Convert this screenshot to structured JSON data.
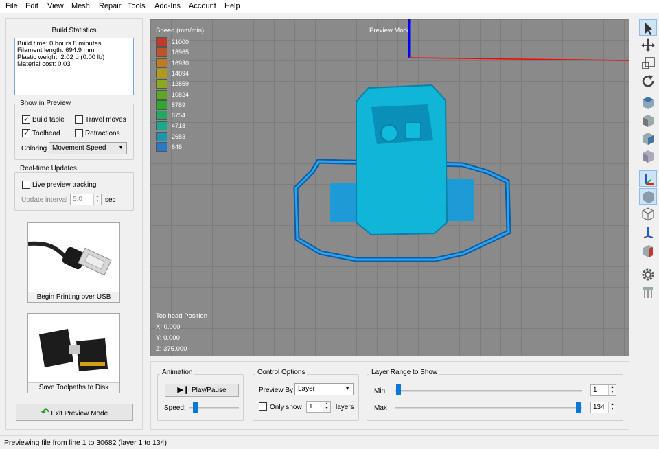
{
  "menu": [
    "File",
    "Edit",
    "View",
    "Mesh",
    "Repair",
    "Tools",
    "Add-Ins",
    "Account",
    "Help"
  ],
  "build_statistics": {
    "title": "Build Statistics",
    "build_time": "Build time: 0 hours 8 minutes",
    "filament_length": "Filament length: 694.9 mm",
    "plastic_weight": "Plastic weight: 2.02 g (0.00 lb)",
    "material_cost": "Material cost: 0.03"
  },
  "show_in_preview": {
    "title": "Show in Preview",
    "build_table": {
      "label": "Build table",
      "checked": true
    },
    "travel_moves": {
      "label": "Travel moves",
      "checked": false
    },
    "toolhead": {
      "label": "Toolhead",
      "checked": true
    },
    "retractions": {
      "label": "Retractions",
      "checked": false
    },
    "coloring_label": "Coloring",
    "coloring_value": "Movement Speed"
  },
  "realtime": {
    "title": "Real-time Updates",
    "live_preview_label": "Live preview tracking",
    "live_preview_checked": false,
    "update_interval_label": "Update interval",
    "update_interval_value": "5.0",
    "update_interval_unit": "sec"
  },
  "usb_button": {
    "caption": "Begin Printing over USB"
  },
  "sd_button": {
    "caption": "Save Toolpaths to Disk"
  },
  "exit_button": {
    "label": "Exit Preview Mode"
  },
  "viewport": {
    "legend_title": "Speed (mm/min)",
    "preview_mode_label": "Preview Mode",
    "legend": [
      {
        "value": "21000",
        "color": "#c0392b"
      },
      {
        "value": "18965",
        "color": "#c0532b"
      },
      {
        "value": "16930",
        "color": "#c07a1f"
      },
      {
        "value": "14894",
        "color": "#b09a1c"
      },
      {
        "value": "12859",
        "color": "#8aa820"
      },
      {
        "value": "10824",
        "color": "#5aa828"
      },
      {
        "value": "8789",
        "color": "#30a830"
      },
      {
        "value": "6754",
        "color": "#22a860"
      },
      {
        "value": "4718",
        "color": "#1aa890"
      },
      {
        "value": "2683",
        "color": "#1a98b0"
      },
      {
        "value": "648",
        "color": "#2a78c8"
      }
    ],
    "toolhead_position_title": "Toolhead Position",
    "x": "X: 0.000",
    "y": "Y: 0.000",
    "z": "Z: 375.000"
  },
  "animation": {
    "title": "Animation",
    "play_pause_label": "Play/Pause",
    "speed_label": "Speed:",
    "speed_level": 0.08
  },
  "control_options": {
    "title": "Control Options",
    "preview_by_label": "Preview By",
    "preview_by_value": "Layer",
    "only_show_label": "Only show",
    "only_show_checked": false,
    "only_show_value": "1",
    "layers_label": "layers"
  },
  "layer_range": {
    "title": "Layer Range to Show",
    "min_label": "Min",
    "min_value": "1",
    "max_label": "Max",
    "max_value": "134"
  },
  "toolbar_icons": [
    "select-cursor-icon",
    "move-icon",
    "scale-icon",
    "rotate-icon",
    "view-cube-top-icon",
    "view-cube-front-icon",
    "view-cube-side-icon",
    "view-cube-iso-icon",
    "axes-icon",
    "solid-cube-icon",
    "wireframe-cube-icon",
    "axis-arrow-icon",
    "section-cube-icon",
    "settings-gear-icon",
    "supports-icon"
  ],
  "status": "Previewing file from line 1 to 30682 (layer 1 to 134)"
}
